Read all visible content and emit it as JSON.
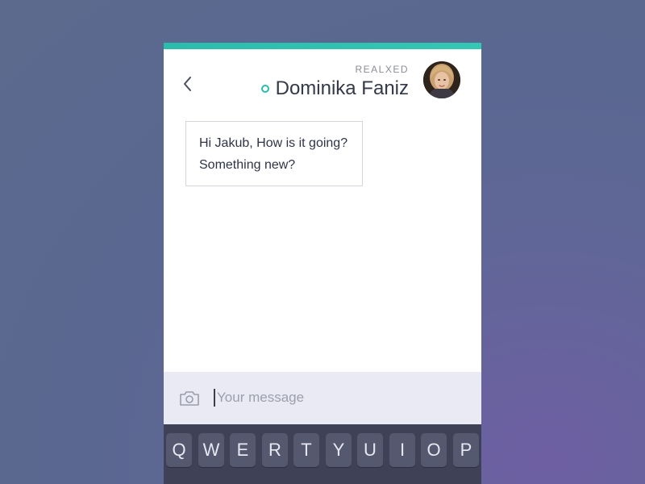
{
  "colors": {
    "accent_start": "#2bbcad",
    "accent_end": "#35c6b4",
    "online_status": "#2bbbad",
    "message_border": "#d4d6dc",
    "input_bar": "#e9eaf3",
    "keyboard_bg": "#3f4257",
    "key_bg": "#555970"
  },
  "header": {
    "back_icon": "chevron-left-icon",
    "status": "REALXED",
    "contact_name": "Dominika Faniz",
    "avatar_icon": "avatar-photo"
  },
  "conversation": {
    "messages": [
      {
        "line1": "Hi Jakub, How is it going?",
        "line2": "Something new?"
      }
    ]
  },
  "composer": {
    "camera_icon": "camera-icon",
    "placeholder": "Your message",
    "value": ""
  },
  "keyboard": {
    "keys": [
      "Q",
      "W",
      "E",
      "R",
      "T",
      "Y",
      "U",
      "I",
      "O",
      "P"
    ]
  }
}
